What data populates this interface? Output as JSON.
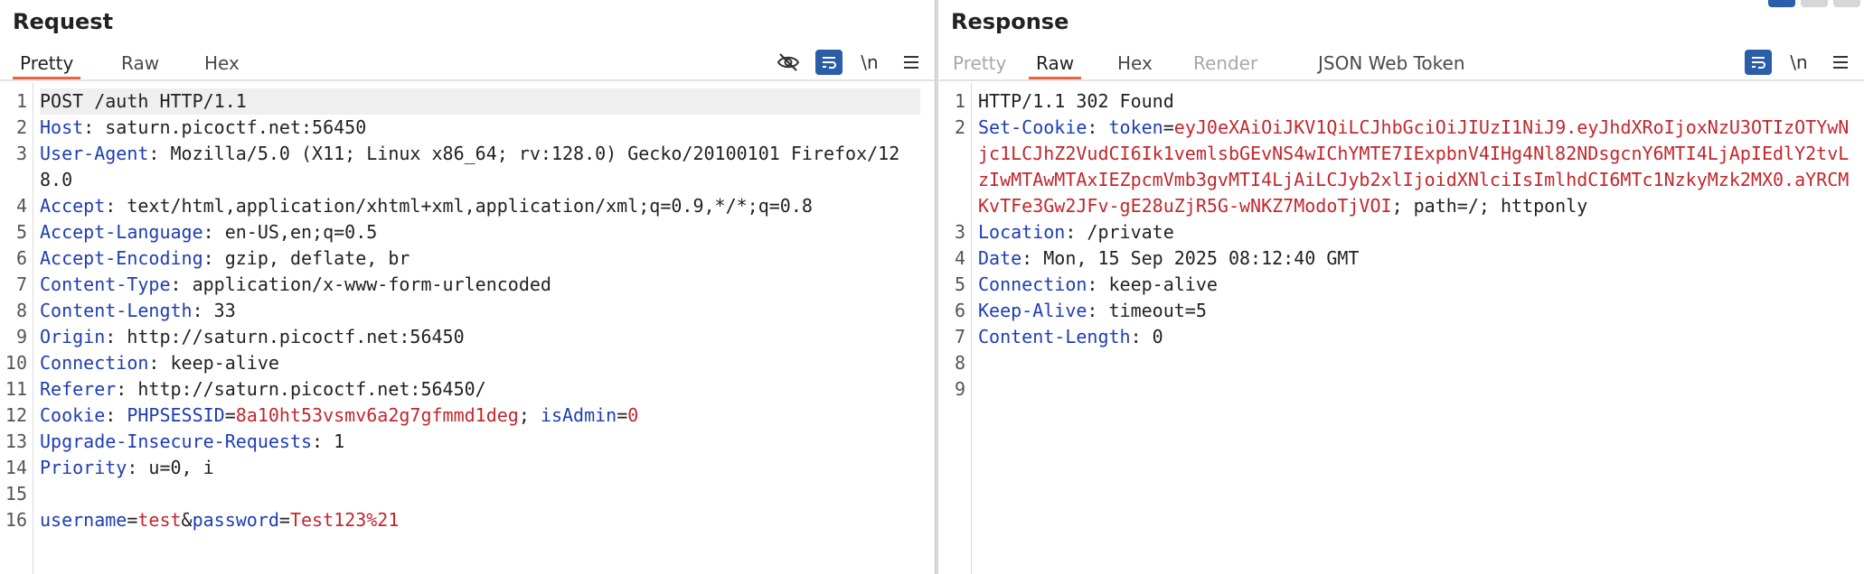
{
  "request": {
    "title": "Request",
    "tabs": [
      {
        "label": "Pretty",
        "state": "active"
      },
      {
        "label": "Raw",
        "state": "normal"
      },
      {
        "label": "Hex",
        "state": "normal"
      }
    ],
    "tool_icons": [
      "eye-slash-icon",
      "wrap-icon",
      "newline-icon",
      "menu-icon"
    ],
    "newline_label": "\\n",
    "lines": [
      {
        "n": "1",
        "segs": [
          {
            "t": "POST /auth HTTP/1.1",
            "c": "p"
          }
        ],
        "current": true
      },
      {
        "n": "2",
        "segs": [
          {
            "t": "Host",
            "c": "k"
          },
          {
            "t": ": saturn.picoctf.net:56450",
            "c": "v"
          }
        ]
      },
      {
        "n": "3",
        "segs": [
          {
            "t": "User-Agent",
            "c": "k"
          },
          {
            "t": ": Mozilla/5.0 (X11; Linux x86_64; rv:128.0) Gecko/20100101 Firefox/128.0",
            "c": "v"
          }
        ]
      },
      {
        "n": "4",
        "segs": [
          {
            "t": "Accept",
            "c": "k"
          },
          {
            "t": ": text/html,application/xhtml+xml,application/xml;q=0.9,*/*;q=0.8",
            "c": "v"
          }
        ]
      },
      {
        "n": "5",
        "segs": [
          {
            "t": "Accept-Language",
            "c": "k"
          },
          {
            "t": ": en-US,en;q=0.5",
            "c": "v"
          }
        ]
      },
      {
        "n": "6",
        "segs": [
          {
            "t": "Accept-Encoding",
            "c": "k"
          },
          {
            "t": ": gzip, deflate, br",
            "c": "v"
          }
        ]
      },
      {
        "n": "7",
        "segs": [
          {
            "t": "Content-Type",
            "c": "k"
          },
          {
            "t": ": application/x-www-form-urlencoded",
            "c": "v"
          }
        ]
      },
      {
        "n": "8",
        "segs": [
          {
            "t": "Content-Length",
            "c": "k"
          },
          {
            "t": ": 33",
            "c": "v"
          }
        ]
      },
      {
        "n": "9",
        "segs": [
          {
            "t": "Origin",
            "c": "k"
          },
          {
            "t": ": http://saturn.picoctf.net:56450",
            "c": "v"
          }
        ]
      },
      {
        "n": "10",
        "segs": [
          {
            "t": "Connection",
            "c": "k"
          },
          {
            "t": ": keep-alive",
            "c": "v"
          }
        ]
      },
      {
        "n": "11",
        "segs": [
          {
            "t": "Referer",
            "c": "k"
          },
          {
            "t": ": http://saturn.picoctf.net:56450/",
            "c": "v"
          }
        ]
      },
      {
        "n": "12",
        "segs": [
          {
            "t": "Cookie",
            "c": "k"
          },
          {
            "t": ": ",
            "c": "v"
          },
          {
            "t": "PHPSESSID",
            "c": "k"
          },
          {
            "t": "=",
            "c": "v"
          },
          {
            "t": "8a10ht53vsmv6a2g7gfmmd1deg",
            "c": "r"
          },
          {
            "t": "; ",
            "c": "v"
          },
          {
            "t": "isAdmin",
            "c": "k"
          },
          {
            "t": "=",
            "c": "v"
          },
          {
            "t": "0",
            "c": "r"
          }
        ]
      },
      {
        "n": "13",
        "segs": [
          {
            "t": "Upgrade-Insecure-Requests",
            "c": "k"
          },
          {
            "t": ": 1",
            "c": "v"
          }
        ]
      },
      {
        "n": "14",
        "segs": [
          {
            "t": "Priority",
            "c": "k"
          },
          {
            "t": ": u=0, i",
            "c": "v"
          }
        ]
      },
      {
        "n": "15",
        "segs": [
          {
            "t": "",
            "c": "v"
          }
        ]
      },
      {
        "n": "16",
        "segs": [
          {
            "t": "username",
            "c": "k"
          },
          {
            "t": "=",
            "c": "v"
          },
          {
            "t": "test",
            "c": "r"
          },
          {
            "t": "&",
            "c": "v"
          },
          {
            "t": "password",
            "c": "k"
          },
          {
            "t": "=",
            "c": "v"
          },
          {
            "t": "Test123%21",
            "c": "r"
          }
        ]
      }
    ]
  },
  "response": {
    "title": "Response",
    "tabs": [
      {
        "label": "Pretty",
        "state": "disabled"
      },
      {
        "label": "Raw",
        "state": "active"
      },
      {
        "label": "Hex",
        "state": "normal"
      },
      {
        "label": "Render",
        "state": "disabled"
      },
      {
        "label": "JSON Web Token",
        "state": "normal"
      }
    ],
    "tool_icons": [
      "wrap-icon",
      "newline-icon",
      "menu-icon"
    ],
    "newline_label": "\\n",
    "lines": [
      {
        "n": "1",
        "segs": [
          {
            "t": "HTTP/1.1 302 Found",
            "c": "p"
          }
        ]
      },
      {
        "n": "2",
        "segs": [
          {
            "t": "Set-Cookie",
            "c": "k"
          },
          {
            "t": ": ",
            "c": "v"
          },
          {
            "t": "token",
            "c": "k"
          },
          {
            "t": "=",
            "c": "v"
          },
          {
            "t": "eyJ0eXAiOiJKV1QiLCJhbGciOiJIUzI1NiJ9.eyJhdXRoIjoxNzU3OTIzOTYwNjc1LCJhZ2VudCI6Ik1vemlsbGEvNS4wIChYMTE7IExpbnV4IHg4Nl82NDsgcnY6MTI4LjApIEdlY2tvLzIwMTAwMTAxIEZpcmVmb3gvMTI4LjAiLCJyb2xlIjoidXNlciIsImlhdCI6MTc1NzkyMzk2MX0.aYRCMKvTFe3Gw2JFv-gE28uZjR5G-wNKZ7ModoTjVOI",
            "c": "r"
          },
          {
            "t": "; path=/; httponly",
            "c": "v"
          }
        ]
      },
      {
        "n": "3",
        "segs": [
          {
            "t": "Location",
            "c": "k"
          },
          {
            "t": ": /private",
            "c": "v"
          }
        ]
      },
      {
        "n": "4",
        "segs": [
          {
            "t": "Date",
            "c": "k"
          },
          {
            "t": ": Mon, 15 Sep 2025 08:12:40 GMT",
            "c": "v"
          }
        ]
      },
      {
        "n": "5",
        "segs": [
          {
            "t": "Connection",
            "c": "k"
          },
          {
            "t": ": keep-alive",
            "c": "v"
          }
        ]
      },
      {
        "n": "6",
        "segs": [
          {
            "t": "Keep-Alive",
            "c": "k"
          },
          {
            "t": ": timeout=5",
            "c": "v"
          }
        ]
      },
      {
        "n": "7",
        "segs": [
          {
            "t": "Content-Length",
            "c": "k"
          },
          {
            "t": ": 0",
            "c": "v"
          }
        ]
      },
      {
        "n": "8",
        "segs": [
          {
            "t": "",
            "c": "v"
          }
        ]
      },
      {
        "n": "9",
        "segs": [
          {
            "t": "",
            "c": "v"
          }
        ]
      }
    ]
  },
  "colors": {
    "key_blue": "#1e3db4",
    "value_red": "#c2272d",
    "accent_orange": "#e8663d",
    "button_blue": "#2a5ea8"
  }
}
